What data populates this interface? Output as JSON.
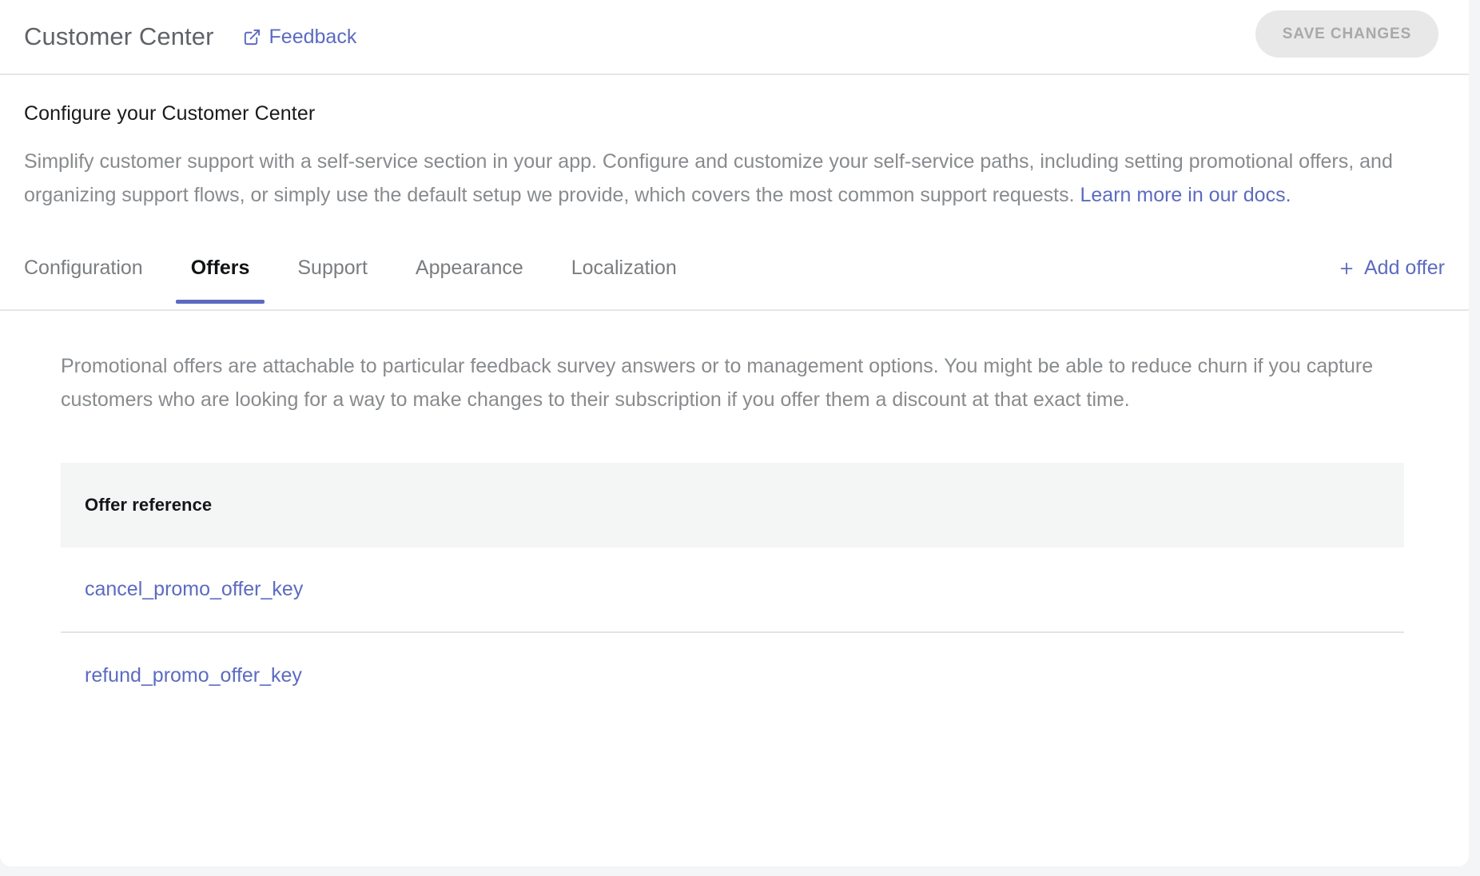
{
  "header": {
    "title": "Customer Center",
    "feedback_label": "Feedback",
    "feedback_icon": "external-link-icon",
    "save_label": "SAVE CHANGES",
    "save_disabled": true
  },
  "intro": {
    "heading": "Configure your Customer Center",
    "body": "Simplify customer support with a self-service section in your app. Configure and customize your self-service paths, including setting promotional offers, and organizing support flows, or simply use the default setup we provide, which covers the most common support requests. ",
    "link_label": "Learn more in our docs."
  },
  "tabs": {
    "items": [
      {
        "label": "Configuration",
        "active": false
      },
      {
        "label": "Offers",
        "active": true
      },
      {
        "label": "Support",
        "active": false
      },
      {
        "label": "Appearance",
        "active": false
      },
      {
        "label": "Localization",
        "active": false
      }
    ],
    "add_offer_label": "Add offer",
    "add_offer_icon": "plus-icon"
  },
  "offers_panel": {
    "description": "Promotional offers are attachable to particular feedback survey answers or to management options. You might be able to reduce churn if you capture customers who are looking for a way to make changes to their subscription if you offer them a discount at that exact time.",
    "table": {
      "columns": [
        "Offer reference"
      ],
      "rows": [
        {
          "offer_reference": "cancel_promo_offer_key"
        },
        {
          "offer_reference": "refund_promo_offer_key"
        }
      ]
    }
  },
  "colors": {
    "accent": "#5c6bc0",
    "page_background": "#f4f5f6",
    "card_background": "#ffffff",
    "muted_text": "#888b8e",
    "table_header_background": "#f4f5f5",
    "disabled_button_background": "#e8e8e8",
    "disabled_button_text": "#a9a9a9"
  }
}
